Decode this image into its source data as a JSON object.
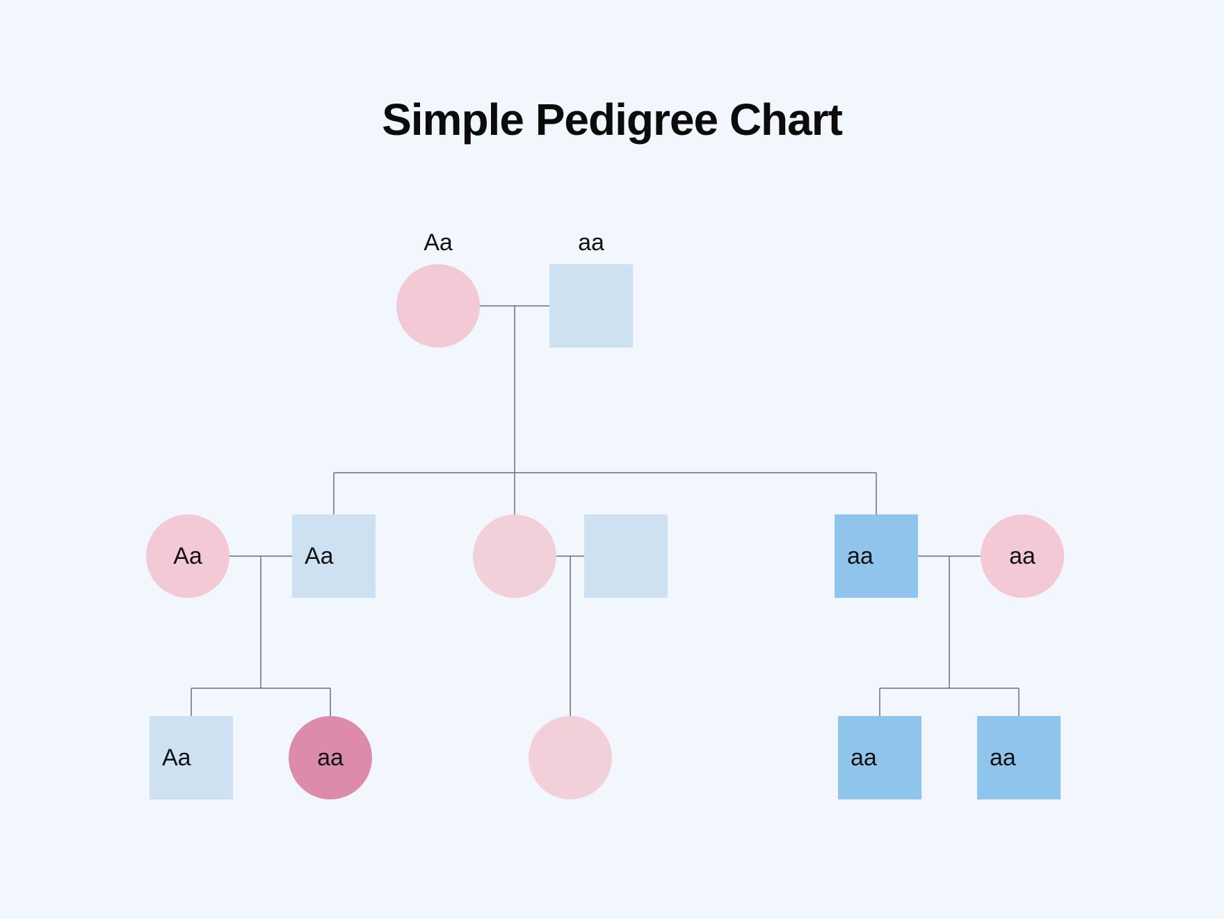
{
  "title": "Simple Pedigree Chart",
  "colors": {
    "pink_light": "#f2c9d4",
    "pink_dark": "#dc8caa",
    "blue_pale": "#cde1f2",
    "blue_mid": "#8fc5ec",
    "line": "#6d6d6d",
    "bg": "#f2f7fd"
  },
  "chart_data": {
    "type": "pedigree",
    "legend": {
      "circle": "female",
      "square": "male"
    },
    "generations": [
      {
        "index": 1,
        "members": [
          {
            "id": "I-1",
            "sex": "female",
            "shape": "circle",
            "fill": "pink_light",
            "genotype": "Aa",
            "label_pos": "above"
          },
          {
            "id": "I-2",
            "sex": "male",
            "shape": "square",
            "fill": "blue_pale",
            "genotype": "aa",
            "label_pos": "above"
          }
        ],
        "couples": [
          {
            "left": "I-1",
            "right": "I-2",
            "children": [
              "II-2",
              "II-3",
              "II-5"
            ]
          }
        ]
      },
      {
        "index": 2,
        "members": [
          {
            "id": "II-1",
            "sex": "female",
            "shape": "circle",
            "fill": "pink_light",
            "genotype": "Aa",
            "label_pos": "inside"
          },
          {
            "id": "II-2",
            "sex": "male",
            "shape": "square",
            "fill": "blue_pale",
            "genotype": "Aa",
            "label_pos": "inside"
          },
          {
            "id": "II-3",
            "sex": "female",
            "shape": "circle",
            "fill": "pink_light",
            "genotype": "",
            "label_pos": "none"
          },
          {
            "id": "II-4",
            "sex": "male",
            "shape": "square",
            "fill": "blue_pale",
            "genotype": "",
            "label_pos": "none"
          },
          {
            "id": "II-5",
            "sex": "male",
            "shape": "square",
            "fill": "blue_mid",
            "genotype": "aa",
            "label_pos": "inside"
          },
          {
            "id": "II-6",
            "sex": "female",
            "shape": "circle",
            "fill": "pink_light",
            "genotype": "aa",
            "label_pos": "inside"
          }
        ],
        "couples": [
          {
            "left": "II-1",
            "right": "II-2",
            "children": [
              "III-1",
              "III-2"
            ]
          },
          {
            "left": "II-3",
            "right": "II-4",
            "children": [
              "III-3"
            ]
          },
          {
            "left": "II-5",
            "right": "II-6",
            "children": [
              "III-4",
              "III-5"
            ]
          }
        ]
      },
      {
        "index": 3,
        "members": [
          {
            "id": "III-1",
            "sex": "male",
            "shape": "square",
            "fill": "blue_pale",
            "genotype": "Aa",
            "label_pos": "inside"
          },
          {
            "id": "III-2",
            "sex": "female",
            "shape": "circle",
            "fill": "pink_dark",
            "genotype": "aa",
            "label_pos": "inside"
          },
          {
            "id": "III-3",
            "sex": "female",
            "shape": "circle",
            "fill": "pink_light",
            "genotype": "",
            "label_pos": "none"
          },
          {
            "id": "III-4",
            "sex": "male",
            "shape": "square",
            "fill": "blue_mid",
            "genotype": "aa",
            "label_pos": "inside"
          },
          {
            "id": "III-5",
            "sex": "male",
            "shape": "square",
            "fill": "blue_mid",
            "genotype": "aa",
            "label_pos": "inside"
          }
        ]
      }
    ]
  },
  "nodes": {
    "g1_female": {
      "genotype": "Aa"
    },
    "g1_male": {
      "genotype": "aa"
    },
    "g2_p1_f": {
      "genotype": "Aa"
    },
    "g2_p1_m": {
      "genotype": "Aa"
    },
    "g2_p2_f": {
      "genotype": ""
    },
    "g2_p2_m": {
      "genotype": ""
    },
    "g2_p3_m": {
      "genotype": "aa"
    },
    "g2_p3_f": {
      "genotype": "aa"
    },
    "g3_c1": {
      "genotype": "Aa"
    },
    "g3_c2": {
      "genotype": "aa"
    },
    "g3_c3": {
      "genotype": ""
    },
    "g3_c4": {
      "genotype": "aa"
    },
    "g3_c5": {
      "genotype": "aa"
    }
  }
}
